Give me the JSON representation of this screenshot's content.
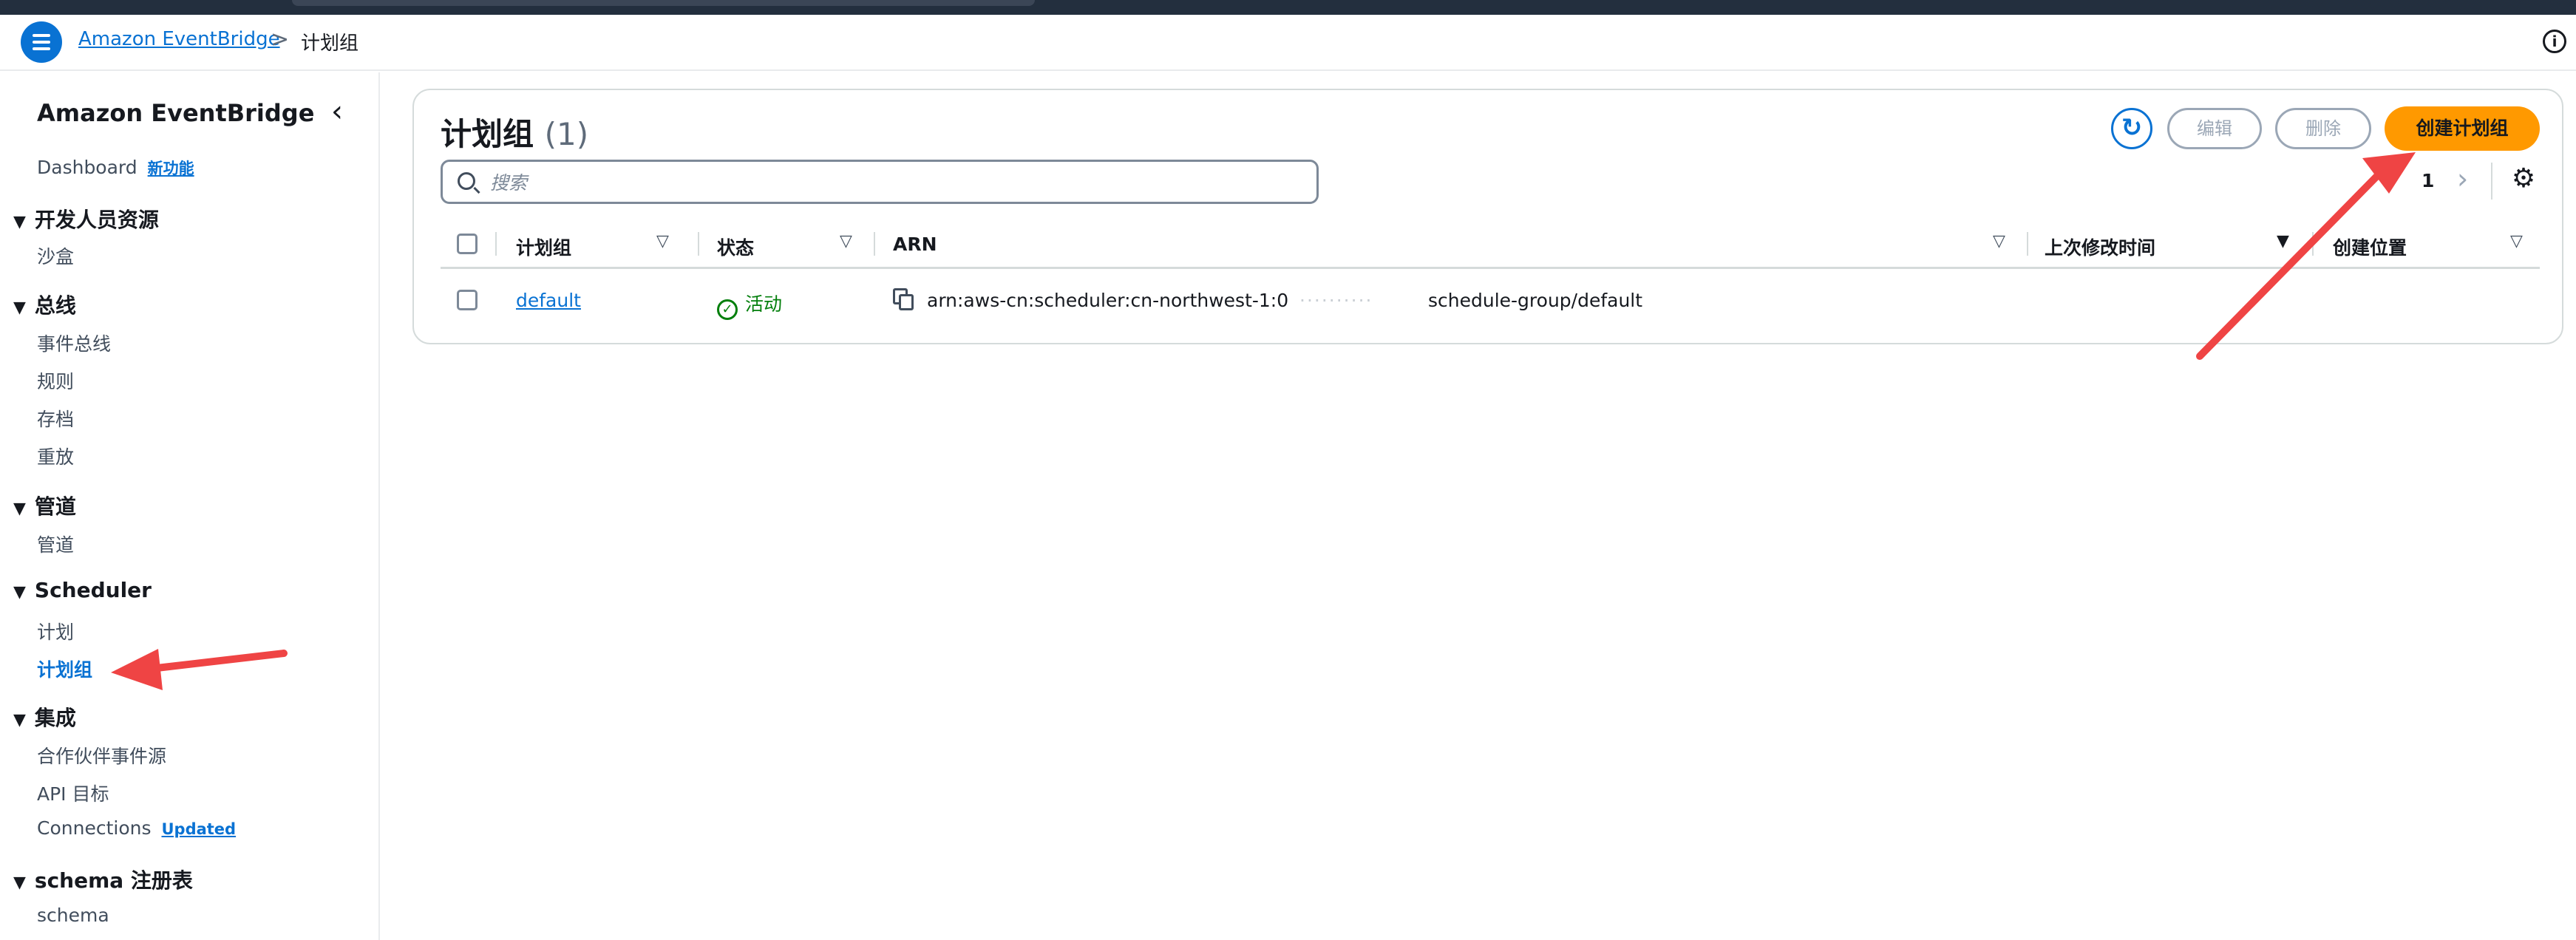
{
  "breadcrumb": {
    "root": "Amazon EventBridge",
    "separator": ">",
    "current": "计划组"
  },
  "sidebar": {
    "title": "Amazon EventBridge",
    "dashboard": {
      "label": "Dashboard",
      "badge": "新功能"
    },
    "sections": {
      "dev": {
        "label": "开发人员资源",
        "items": [
          "沙盒"
        ]
      },
      "bus": {
        "label": "总线",
        "items": [
          "事件总线",
          "规则",
          "存档",
          "重放"
        ]
      },
      "pipes": {
        "label": "管道",
        "items": [
          "管道"
        ]
      },
      "scheduler": {
        "label": "Scheduler",
        "items": [
          "计划",
          "计划组"
        ]
      },
      "integration": {
        "label": "集成",
        "items": [
          "合作伙伴事件源",
          "API 目标",
          "Connections"
        ],
        "connections_badge": "Updated"
      },
      "schema": {
        "label": "schema 注册表",
        "items": [
          "schema"
        ]
      }
    },
    "active_item": "计划组"
  },
  "panel": {
    "title": "计划组",
    "count": "(1)",
    "buttons": {
      "edit": "编辑",
      "delete": "删除",
      "create": "创建计划组"
    },
    "search_placeholder": "搜索",
    "pagination": {
      "current_page": "1"
    },
    "columns": [
      "计划组",
      "状态",
      "ARN",
      "上次修改时间",
      "创建位置"
    ],
    "rows": [
      {
        "name": "default",
        "status": "活动",
        "arn_prefix": "arn:aws-cn:scheduler:cn-northwest-1:0",
        "arn_suffix": "schedule-group/default",
        "last_modified": "",
        "created_in": ""
      }
    ]
  },
  "colors": {
    "accent": "#0972d3",
    "primary_button": "#ff9900",
    "status_active": "#037f0c",
    "annotation_arrow": "#ef4444"
  }
}
